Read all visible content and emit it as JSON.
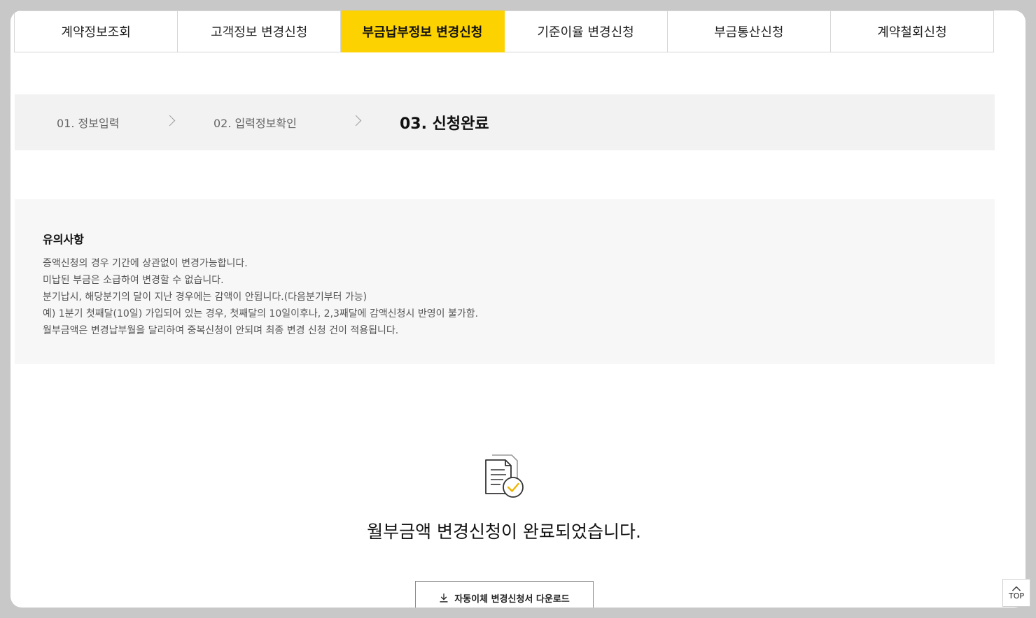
{
  "tabs": [
    {
      "label": "계약정보조회",
      "active": false
    },
    {
      "label": "고객정보 변경신청",
      "active": false
    },
    {
      "label": "부금납부정보 변경신청",
      "active": true
    },
    {
      "label": "기준이율 변경신청",
      "active": false
    },
    {
      "label": "부금통산신청",
      "active": false
    },
    {
      "label": "계약철회신청",
      "active": false
    }
  ],
  "steps": [
    {
      "label": "01. 정보입력"
    },
    {
      "label": "02. 입력정보확인"
    },
    {
      "label": "03. 신청완료"
    }
  ],
  "notice": {
    "title": "유의사항",
    "items": [
      "증액신청의 경우 기간에 상관없이 변경가능합니다.",
      "미납된 부금은 소급하여 변경할 수 없습니다.",
      "분기납시, 해당분기의 달이 지난 경우에는 감액이 안됩니다.(다음분기부터 가능)",
      "예) 1분기 첫째달(10일) 가입되어 있는 경우, 첫째달의 10일이후나, 2,3째달에 감액신청시 반영이 불가함.",
      "월부금액은 변경납부월을 달리하여 중복신청이 안되며 최종 변경 신청 건이 적용됩니다."
    ]
  },
  "result": {
    "icon": "document-check-icon",
    "message": "월부금액 변경신청이 완료되었습니다."
  },
  "download_button": {
    "icon": "download-icon",
    "label": "자동이체 변경신청서 다운로드"
  },
  "top_button": {
    "icon": "chevron-up-icon",
    "label": "TOP"
  },
  "colors": {
    "accent": "#fcd200",
    "step_bg": "#f2f2f2",
    "notice_bg": "#f7f7f7"
  }
}
